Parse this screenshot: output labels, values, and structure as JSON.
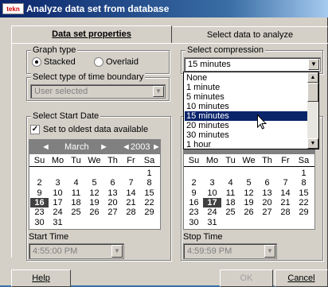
{
  "window": {
    "app_icon_text": "tekn",
    "title": "Analyze data set from database"
  },
  "tabs": [
    {
      "label": "Data set properties",
      "active": true
    },
    {
      "label": "Select data to analyze",
      "active": false
    }
  ],
  "graph_type": {
    "legend": "Graph type",
    "options": [
      {
        "label": "Stacked",
        "selected": true
      },
      {
        "label": "Overlaid",
        "selected": false
      }
    ]
  },
  "time_boundary": {
    "legend": "Select type of time boundary",
    "value": "User selected"
  },
  "compression": {
    "legend": "Select compression",
    "value": "15 minutes",
    "options": [
      "None",
      "1 minute",
      "5 minutes",
      "10 minutes",
      "15 minutes",
      "20 minutes",
      "30 minutes",
      "1 hour"
    ],
    "highlighted": "15 minutes"
  },
  "start_date": {
    "legend": "Select Start Date",
    "checkbox_label": "Set to oldest data available",
    "checked": true,
    "calendar": {
      "month": "March",
      "year": "2003",
      "dow": [
        "Su",
        "Mo",
        "Tu",
        "We",
        "Th",
        "Fr",
        "Sa"
      ],
      "selected_day": "16",
      "weeks": [
        [
          "",
          "",
          "",
          "",
          "",
          "",
          "1"
        ],
        [
          "2",
          "3",
          "4",
          "5",
          "6",
          "7",
          "8"
        ],
        [
          "9",
          "10",
          "11",
          "12",
          "13",
          "14",
          "15"
        ],
        [
          "16",
          "17",
          "18",
          "19",
          "20",
          "21",
          "22"
        ],
        [
          "23",
          "24",
          "25",
          "26",
          "27",
          "28",
          "29"
        ],
        [
          "30",
          "31",
          "",
          "",
          "",
          "",
          ""
        ]
      ]
    },
    "time_label": "Start Time",
    "time_value": "4:55:00 PM"
  },
  "end_date": {
    "calendar": {
      "dow": [
        "Su",
        "Mo",
        "Tu",
        "We",
        "Th",
        "Fr",
        "Sa"
      ],
      "selected_day": "17",
      "weeks": [
        [
          "",
          "",
          "",
          "",
          "",
          "",
          "1"
        ],
        [
          "2",
          "3",
          "4",
          "5",
          "6",
          "7",
          "8"
        ],
        [
          "9",
          "10",
          "11",
          "12",
          "13",
          "14",
          "15"
        ],
        [
          "16",
          "17",
          "18",
          "19",
          "20",
          "21",
          "22"
        ],
        [
          "23",
          "24",
          "25",
          "26",
          "27",
          "28",
          "29"
        ],
        [
          "30",
          "31",
          "",
          "",
          "",
          "",
          ""
        ]
      ]
    },
    "time_label": "Stop Time",
    "time_value": "4:59:59 PM"
  },
  "buttons": {
    "help": "Help",
    "ok": "OK",
    "cancel": "Cancel"
  },
  "icons": {
    "app": "app-icon",
    "cursor": "mouse-pointer-icon"
  }
}
